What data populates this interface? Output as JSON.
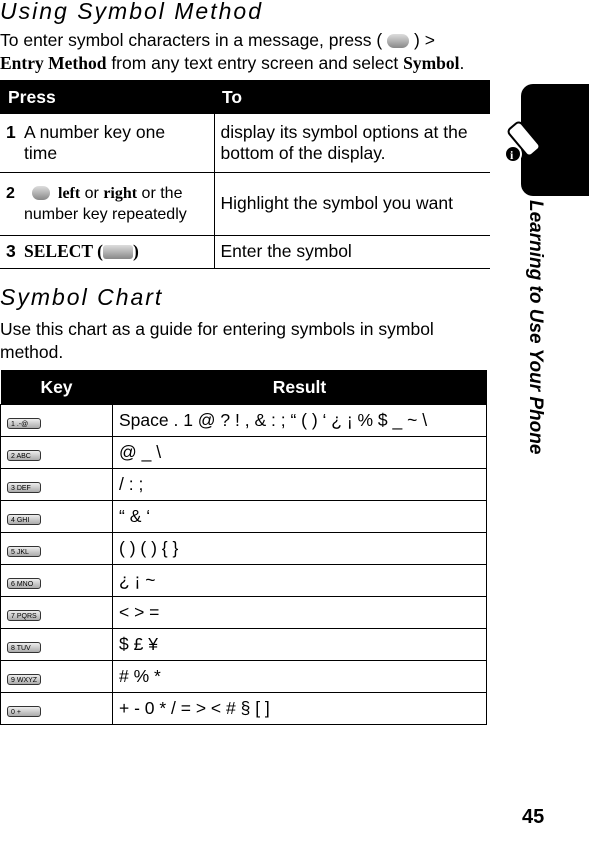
{
  "section1": {
    "title": "Using Symbol Method",
    "intro_a": "To enter symbol characters in a message, press (",
    "intro_b": ") >",
    "intro_menu": "Entry Method",
    "intro_c": " from any text entry screen and select ",
    "intro_symbol": "Symbol",
    "intro_d": "."
  },
  "table1": {
    "headers": [
      "Press",
      "To"
    ],
    "rows": [
      {
        "num": "1",
        "press": "A number key one time",
        "to": "display its symbol options at the bottom of the display."
      },
      {
        "num": "2",
        "press_left": "left",
        "press_or": " or ",
        "press_right": "right",
        "press_rest": " or the number key repeatedly",
        "to": "Highlight the symbol you want"
      },
      {
        "num": "3",
        "press": "SELECT (",
        "press_end": ")",
        "to": "Enter the symbol"
      }
    ]
  },
  "section2": {
    "title": "Symbol Chart",
    "intro": "Use this chart as a guide for entering symbols in symbol method."
  },
  "table2": {
    "headers": [
      "Key",
      "Result"
    ],
    "rows": [
      {
        "key": "1 .-@",
        "result": "Space . 1 @ ? ! , & : ; “ ( ) ‘ ¿ ¡ % $ _ ~ \\"
      },
      {
        "key": "2 ABC",
        "result": "@ _ \\"
      },
      {
        "key": "3 DEF",
        "result": "/ : ;"
      },
      {
        "key": "4 GHI",
        "result": "“ & ‘"
      },
      {
        "key": "5 JKL",
        "result": "( ) ( ) { }"
      },
      {
        "key": "6 MNO",
        "result": "¿ ¡ ~"
      },
      {
        "key": "7 PQRS",
        "result": "< > ="
      },
      {
        "key": "8 TUV",
        "result": "$ £ ¥"
      },
      {
        "key": "9 WXYZ",
        "result": "# % *"
      },
      {
        "key": "0 +",
        "result": "+ - 0 * / = > < # § [   ]"
      }
    ]
  },
  "side_tab": {
    "label": "Learning to Use Your Phone",
    "icon": "phone-info-icon"
  },
  "page_number": "45"
}
